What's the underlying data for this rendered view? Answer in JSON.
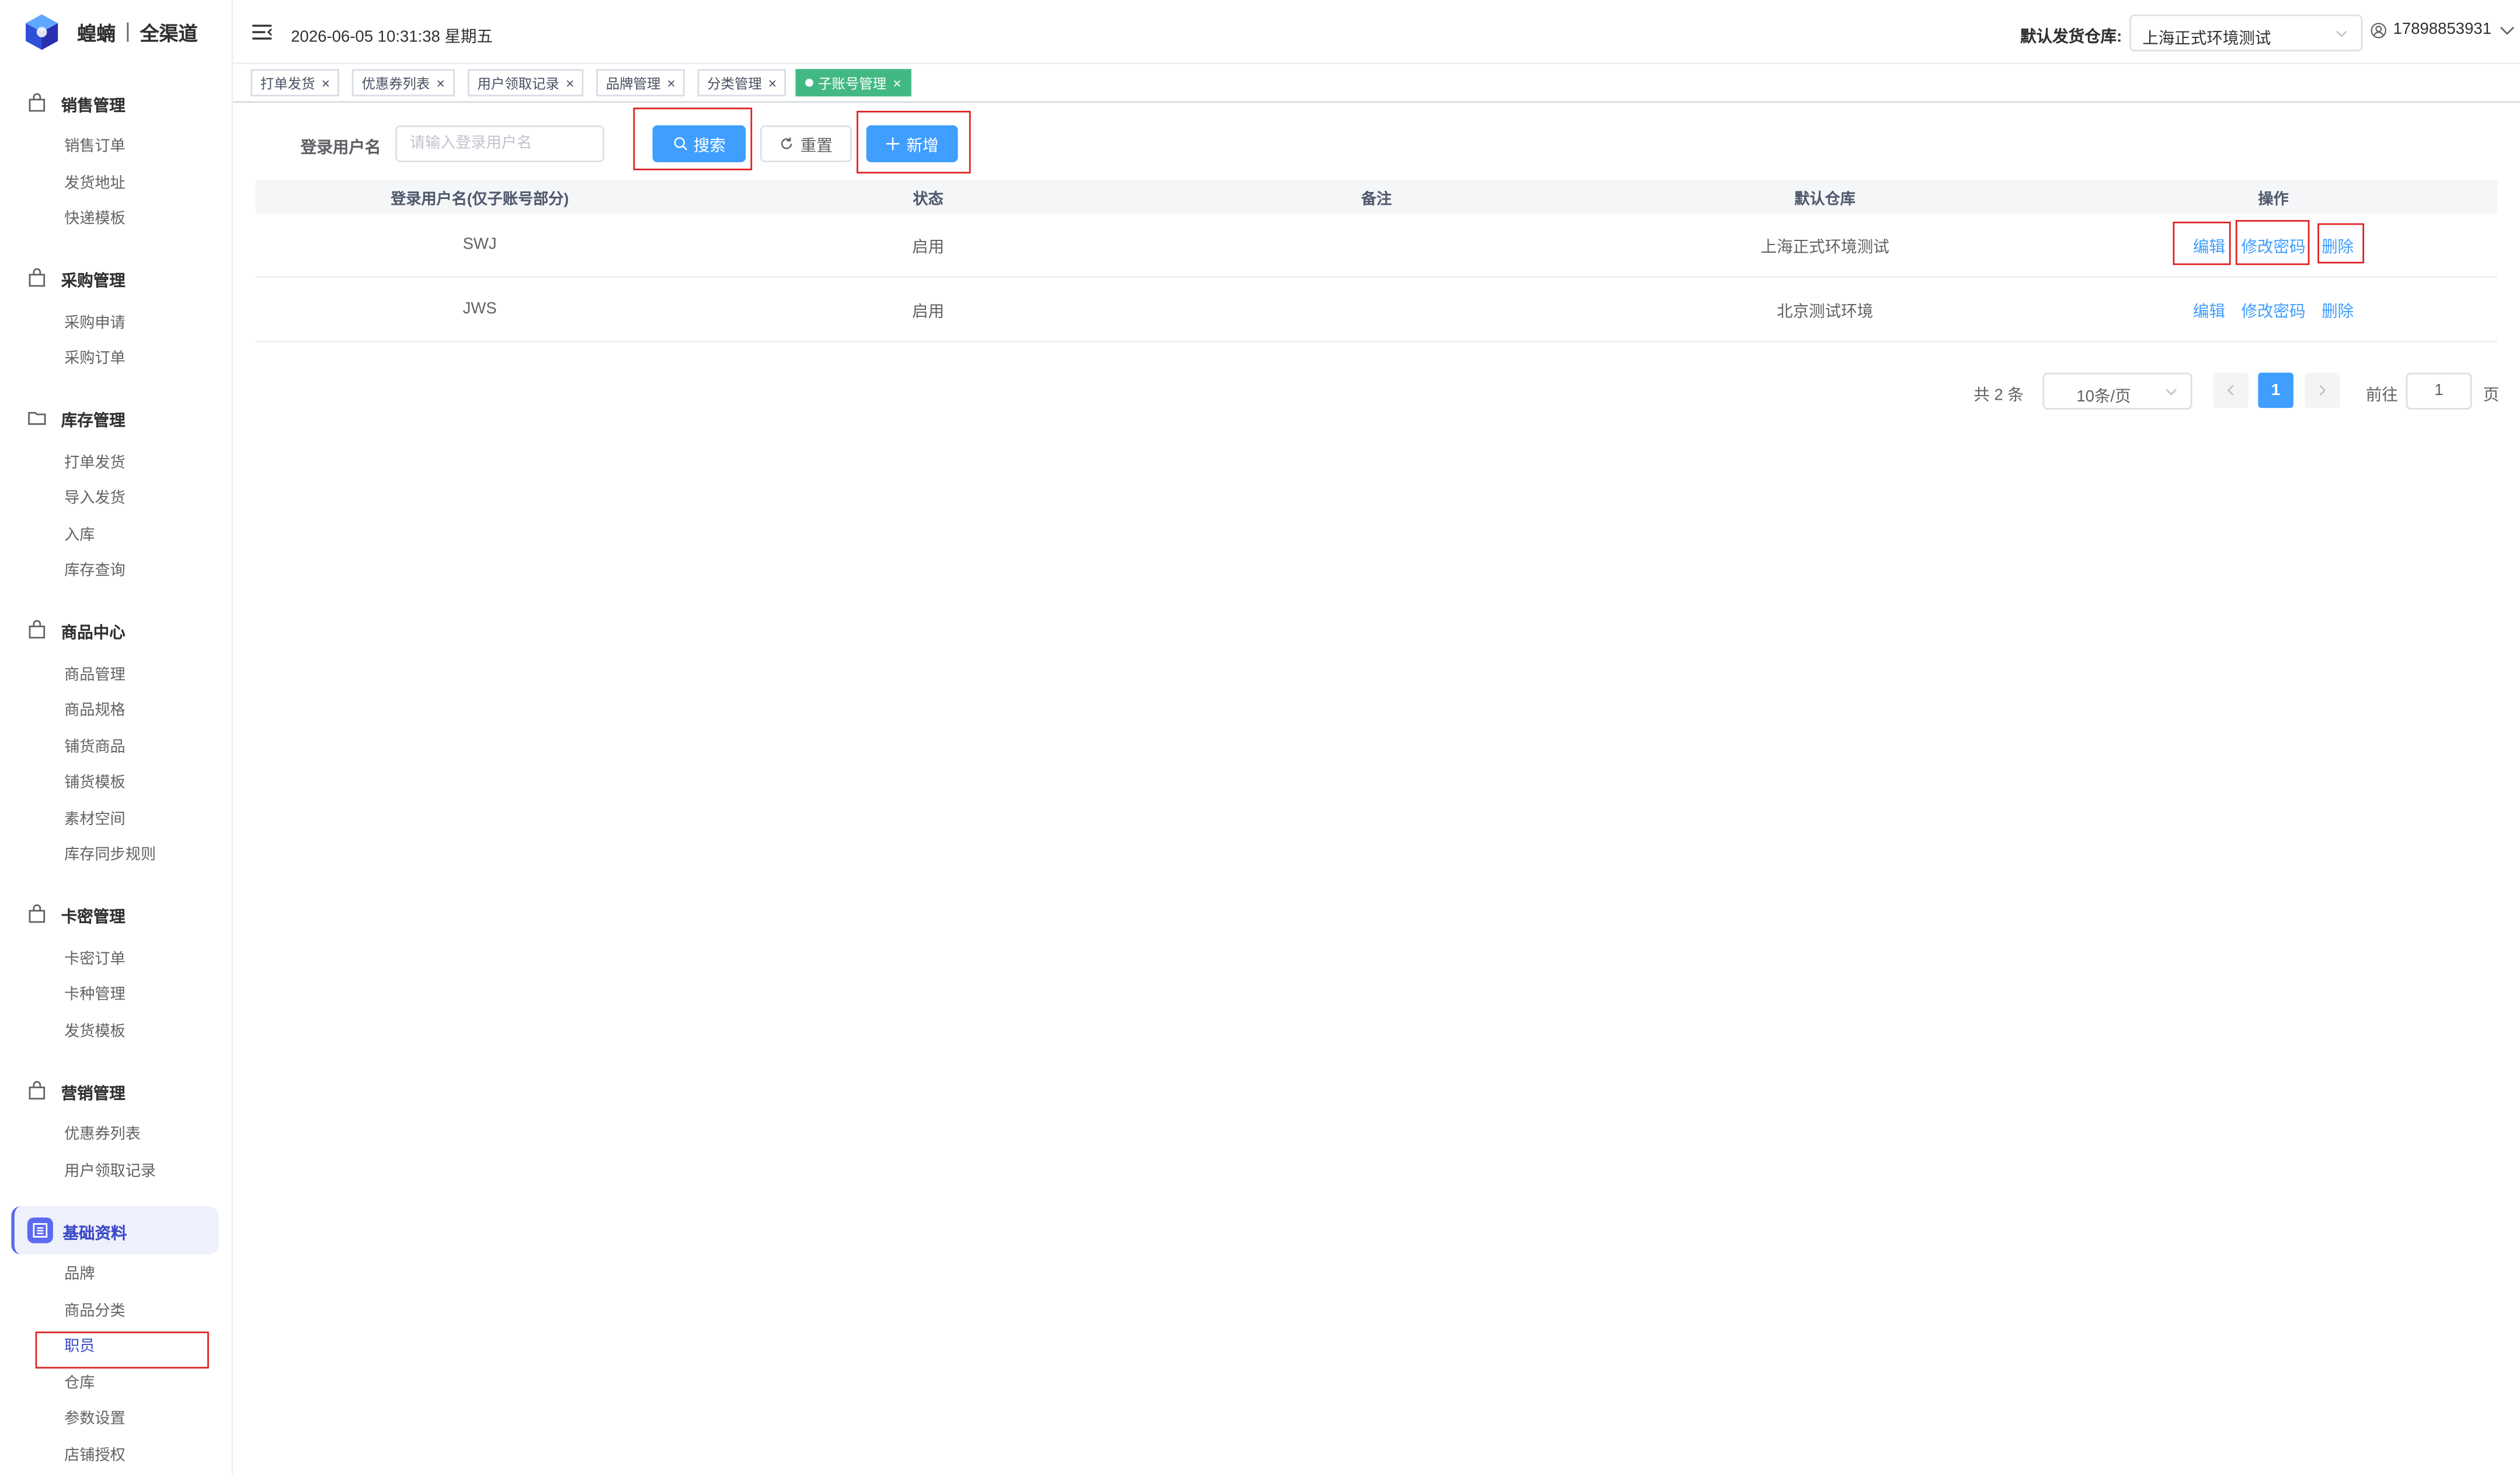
{
  "brand": {
    "name": "蝗蝻",
    "sub": "全渠道"
  },
  "header": {
    "datetime": "2026-06-05 10:31:38 星期五",
    "warehouse_label": "默认发货仓库:",
    "warehouse_value": "上海正式环境测试",
    "user": "17898853931"
  },
  "sidebar": {
    "groups": [
      {
        "title": "销售管理",
        "icon": "bag-icon",
        "items": [
          "销售订单",
          "发货地址",
          "快递模板"
        ]
      },
      {
        "title": "采购管理",
        "icon": "bag-icon",
        "items": [
          "采购申请",
          "采购订单"
        ]
      },
      {
        "title": "库存管理",
        "icon": "folder-icon",
        "items": [
          "打单发货",
          "导入发货",
          "入库",
          "库存查询"
        ]
      },
      {
        "title": "商品中心",
        "icon": "bag-icon",
        "items": [
          "商品管理",
          "商品规格",
          "铺货商品",
          "铺货模板",
          "素材空间",
          "库存同步规则"
        ]
      },
      {
        "title": "卡密管理",
        "icon": "bag-icon",
        "items": [
          "卡密订单",
          "卡种管理",
          "发货模板"
        ]
      },
      {
        "title": "营销管理",
        "icon": "bag-icon",
        "items": [
          "优惠券列表",
          "用户领取记录"
        ]
      },
      {
        "title": "基础资料",
        "icon": "list-icon",
        "items": [
          "品牌",
          "商品分类",
          "职员",
          "仓库",
          "参数设置",
          "店铺授权"
        ]
      }
    ]
  },
  "tabs": [
    {
      "label": "打单发货",
      "active": false
    },
    {
      "label": "优惠券列表",
      "active": false
    },
    {
      "label": "用户领取记录",
      "active": false
    },
    {
      "label": "品牌管理",
      "active": false
    },
    {
      "label": "分类管理",
      "active": false
    },
    {
      "label": "子账号管理",
      "active": true
    }
  ],
  "search": {
    "label": "登录用户名",
    "placeholder": "请输入登录用户名",
    "search_btn": "搜索",
    "reset_btn": "重置",
    "add_btn": "新增"
  },
  "table": {
    "columns": [
      "登录用户名(仅子账号部分)",
      "状态",
      "备注",
      "默认仓库",
      "操作"
    ],
    "rows": [
      {
        "username": "SWJ",
        "status": "启用",
        "remark": "",
        "warehouse": "上海正式环境测试"
      },
      {
        "username": "JWS",
        "status": "启用",
        "remark": "",
        "warehouse": "北京测试环境"
      }
    ],
    "actions": {
      "edit": "编辑",
      "change_password": "修改密码",
      "delete": "删除"
    }
  },
  "pagination": {
    "total": "共 2 条",
    "page_size": "10条/页",
    "current": "1",
    "goto_label": "前往",
    "goto_value": "1",
    "unit": "页"
  },
  "colors": {
    "primary": "#409eff",
    "active_tab": "#42b983",
    "highlight": "#e02020",
    "sidebar_accent": "#5b6af0"
  }
}
